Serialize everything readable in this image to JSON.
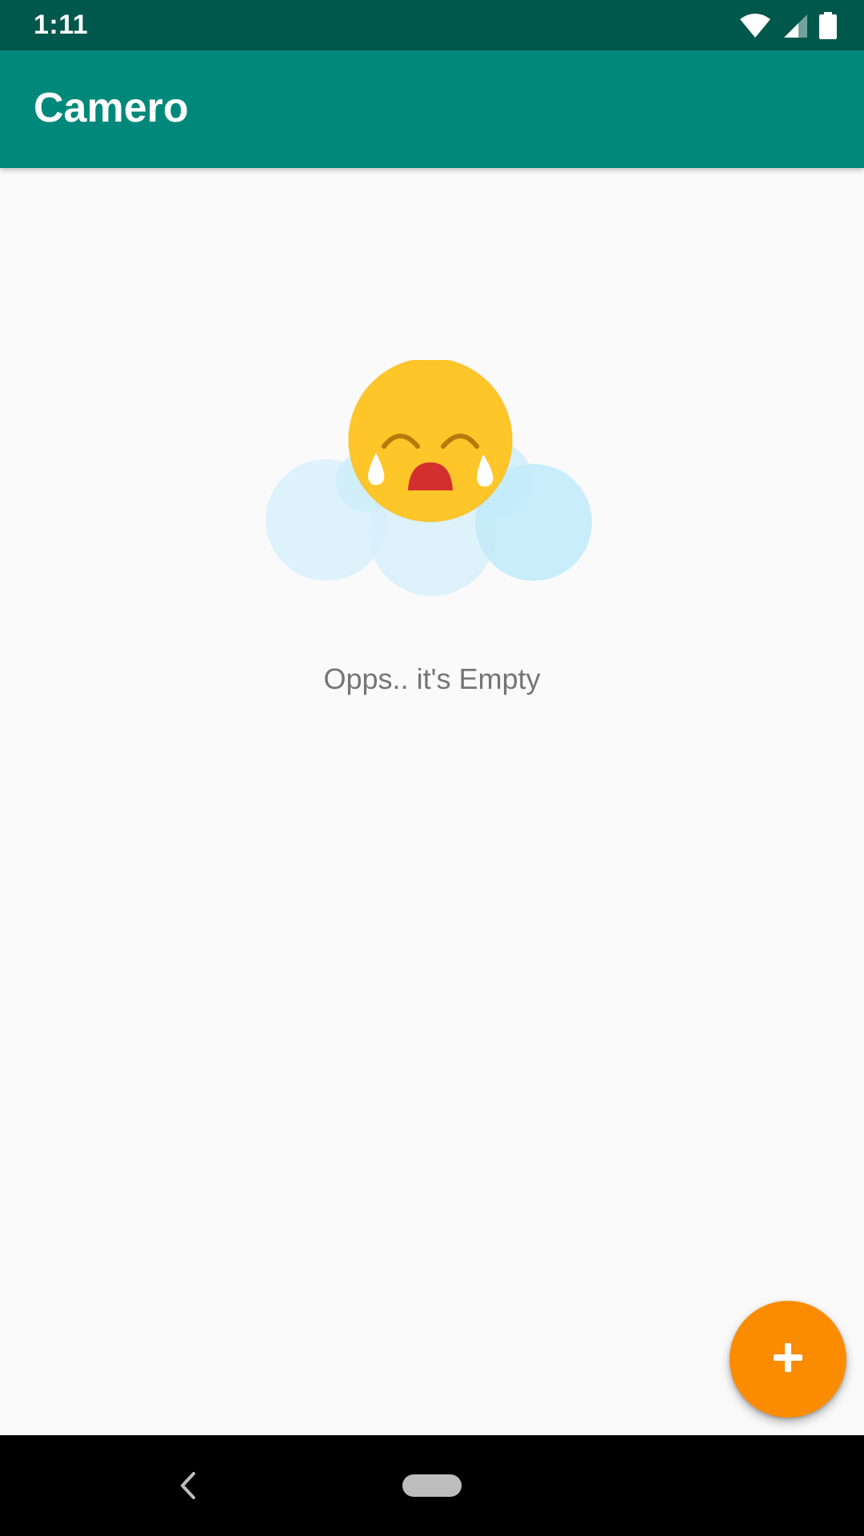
{
  "status_bar": {
    "time": "1:11",
    "icons": [
      "wifi-icon",
      "cellular-signal-icon",
      "battery-icon"
    ],
    "color": "#00574b"
  },
  "app_bar": {
    "title": "Camero",
    "color": "#00897b"
  },
  "empty_state": {
    "illustration": "crying-face-on-cloud-icon",
    "message": "Opps.. it's Empty"
  },
  "fab": {
    "icon": "plus-icon",
    "color": "#fb8c00"
  },
  "nav_bar": {
    "buttons": [
      "back-icon",
      "home-pill-icon"
    ]
  }
}
